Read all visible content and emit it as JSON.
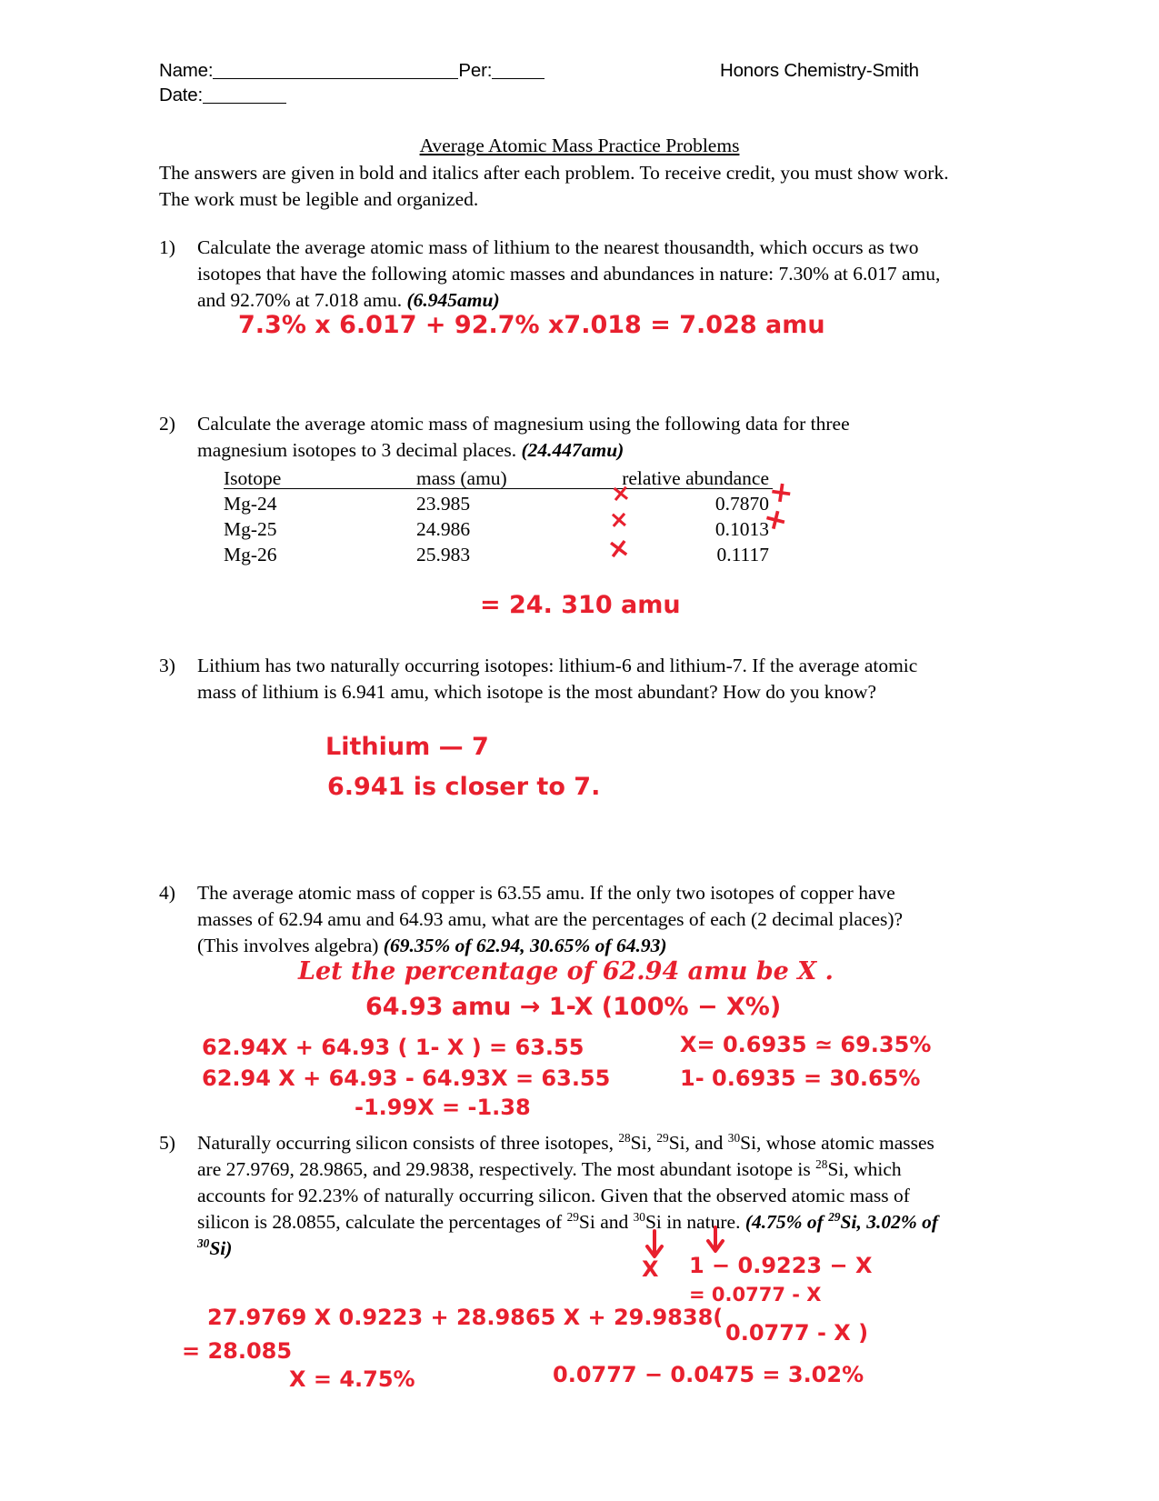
{
  "header": {
    "name_label": "Name:",
    "per_label": "Per:",
    "date_label": "Date:",
    "course": "Honors Chemistry-Smith"
  },
  "title": "Average Atomic Mass Practice Problems",
  "intro": "The answers are given in bold and italics after each problem.  To receive credit, you must show work.  The work must be legible and organized.",
  "problems": [
    {
      "num": "1)",
      "text_a": "Calculate the average atomic mass of lithium to the nearest thousandth, which occurs as two isotopes that have the following atomic masses and abundances in nature: 7.30% at 6.017 amu, and 92.70% at 7.018 amu. ",
      "answer": "(6.945amu)"
    },
    {
      "num": "2)",
      "text_a": "Calculate the average atomic mass of magnesium using the following data for three magnesium isotopes to 3 decimal places. ",
      "answer": "(24.447amu)"
    },
    {
      "num": "3)",
      "text_a": "Lithium has two naturally occurring isotopes: lithium-6 and lithium-7.  If the average atomic mass of lithium is 6.941 amu, which isotope is the most abundant?  How do you know?",
      "answer": ""
    },
    {
      "num": "4)",
      "text_a": "The average atomic mass of copper is 63.55 amu.  If the only two isotopes of copper have masses of 62.94 amu and 64.93 amu, what are the percentages of each (2 decimal places)? (This involves algebra) ",
      "answer": "(69.35% of 62.94, 30.65% of 64.93)"
    }
  ],
  "problem5": {
    "num": "5)",
    "seg1": "Naturally occurring silicon consists of three isotopes, ",
    "sup1": "28",
    "seg2": "Si, ",
    "sup2": "29",
    "seg3": "Si, and ",
    "sup3": "30",
    "seg4": "Si, whose atomic masses are 27.9769, 28.9865, and 29.9838, respectively. The most abundant isotope is ",
    "sup4": "28",
    "seg5": "Si, which accounts for 92.23% of naturally occurring silicon. Given that the observed atomic mass of silicon is 28.0855, calculate the percentages of ",
    "sup5": "29",
    "seg6": "Si and ",
    "sup6": "30",
    "seg7": "Si in nature. ",
    "ans1": "(4.75% of ",
    "ans_sup1": "29",
    "ans2": "Si, ",
    "ans3": "3.02% of ",
    "ans_sup2": "30",
    "ans4": "Si)"
  },
  "table": {
    "columns": [
      "Isotope",
      "mass (amu)",
      "relative abundance"
    ],
    "rows": [
      {
        "isotope": "Mg-24",
        "mass": "23.985",
        "abundance": "0.7870"
      },
      {
        "isotope": "Mg-25",
        "mass": "24.986",
        "abundance": "0.1013"
      },
      {
        "isotope": "Mg-26",
        "mass": "25.983",
        "abundance": "0.1117"
      }
    ]
  },
  "handwriting": {
    "p1_line1": "7.3% x 6.017 + 92.7% x7.018  = 7.028 amu",
    "p2_mark_x1": "×",
    "p2_mark_x2": "×",
    "p2_mark_x3": "×",
    "p2_mark_plus1": "+",
    "p2_mark_plus2": "+",
    "p2_result": "=  24. 310  amu",
    "p3_line1": "Lithium — 7",
    "p3_line2": "6.941  is  closer  to   7.",
    "p4_line1": "Let  the  percentage of  62.94 amu  be  X .",
    "p4_line2": "64.93 amu →   1-X  (100% − X%)",
    "p4_line3": "62.94X +  64.93 ( 1- X )  = 63.55",
    "p4_line4": "62.94 X + 64.93 - 64.93X  = 63.55",
    "p4_line5": "-1.99X   = -1.38",
    "p4_right1": "X= 0.6935 ≃ 69.35%",
    "p4_right2": "1-  0.6935 = 30.65%",
    "p5_mark_x": "X",
    "p5_line1": "1 − 0.9223 − X",
    "p5_line2": "= 0.0777 - X",
    "p5_line3": "27.9769 X 0.9223  +  28.9865 X  + 29.9838(",
    "p5_line3b": "0.0777 - X )",
    "p5_line4": "=  28.085",
    "p5_line5": "X =  4.75%",
    "p5_line6": "0.0777 − 0.0475  = 3.02%"
  },
  "colors": {
    "ink": "#e8202e",
    "text": "#000000",
    "page": "#ffffff"
  }
}
